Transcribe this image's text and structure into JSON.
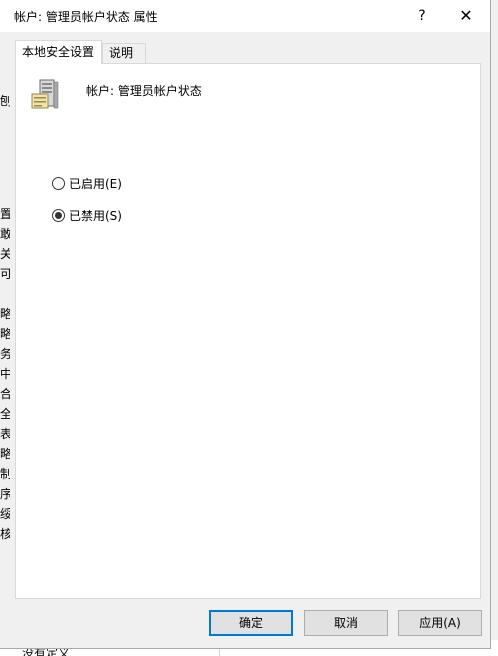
{
  "dialog": {
    "title": "帐户: 管理员帐户状态 属性",
    "help_glyph": "?",
    "close_glyph": "✕"
  },
  "tabs": [
    {
      "label": "本地安全设置",
      "active": true
    },
    {
      "label": "说明",
      "active": false
    }
  ],
  "policy": {
    "name": "帐户: 管理员帐户状态",
    "icon": "server-policy-icon"
  },
  "options": [
    {
      "label": "已启用(E)",
      "checked": false
    },
    {
      "label": "已禁用(S)",
      "checked": true
    }
  ],
  "buttons": {
    "ok": "确定",
    "cancel": "取消",
    "apply": "应用(A)"
  },
  "background": {
    "edge_chars": [
      "刨",
      "置",
      "敢",
      "关",
      "可",
      "略",
      "略",
      "务",
      "中",
      "合",
      "全",
      "表",
      "略",
      "制",
      "序",
      "绥",
      "核"
    ],
    "bottom_text": "没有定义"
  }
}
